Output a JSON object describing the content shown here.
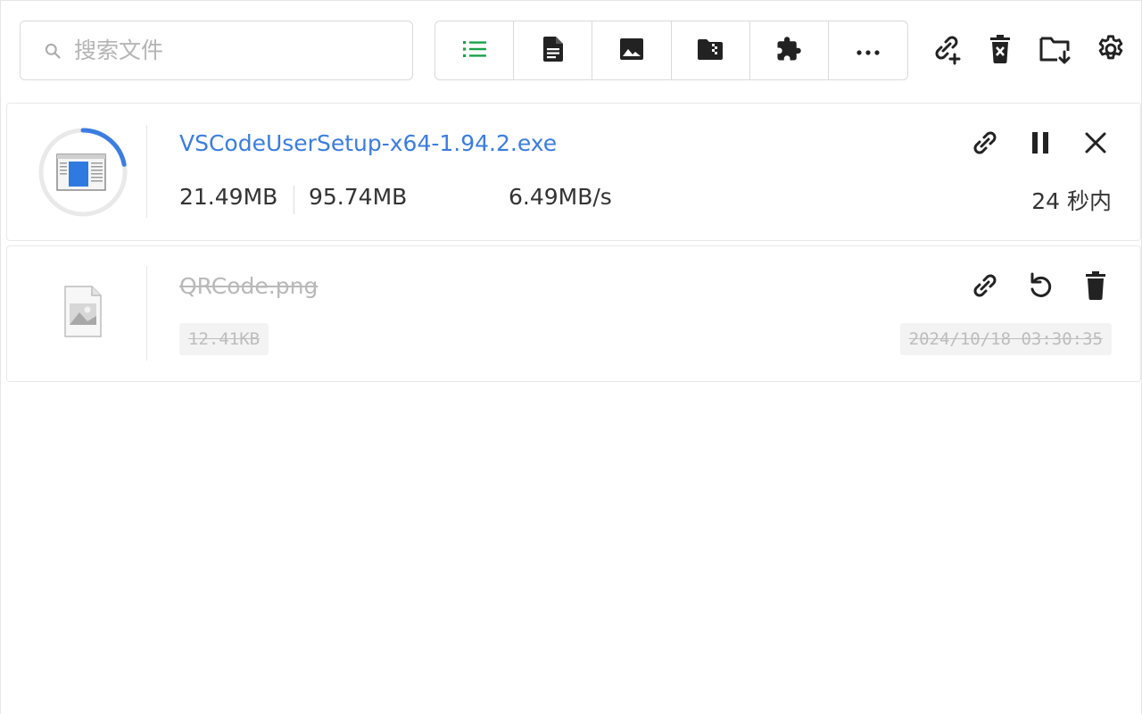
{
  "search": {
    "placeholder": "搜索文件"
  },
  "filters": [
    {
      "name": "all-icon"
    },
    {
      "name": "document-icon"
    },
    {
      "name": "image-icon"
    },
    {
      "name": "archive-icon"
    },
    {
      "name": "extension-icon"
    },
    {
      "name": "more-icon"
    }
  ],
  "toolbar": [
    "add-link-icon",
    "clear-trash-icon",
    "folder-download-icon",
    "settings-icon"
  ],
  "downloads": [
    {
      "file_name": "VSCodeUserSetup-x64-1.94.2.exe",
      "downloaded": "21.49MB",
      "total": "95.74MB",
      "speed": "6.49MB/s",
      "remaining": "24 秒内",
      "progress": 0.22,
      "actions": [
        "link-icon",
        "pause-icon",
        "close-icon"
      ]
    },
    {
      "file_name": "QRCode.png",
      "size": "12.41KB",
      "timestamp": "2024/10/18 03:30:35",
      "actions": [
        "link-icon",
        "retry-icon",
        "delete-icon"
      ]
    }
  ],
  "colors": {
    "accent": "#3b7de0",
    "active_filter": "#1aa34a",
    "icon": "#333333",
    "muted": "#b9b9b9"
  }
}
